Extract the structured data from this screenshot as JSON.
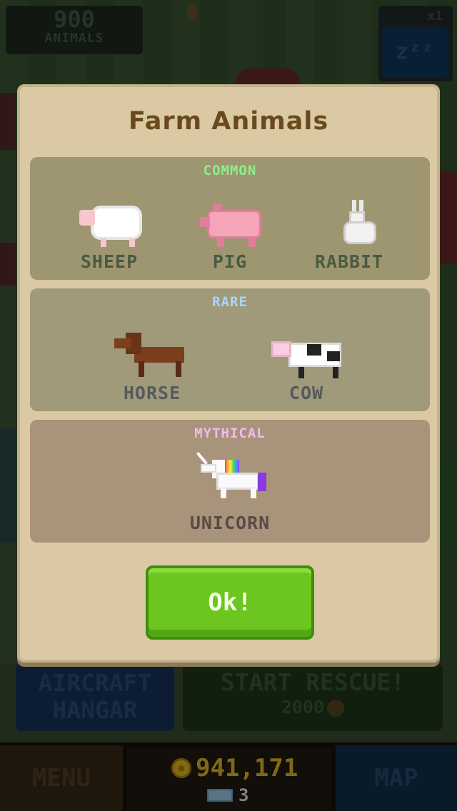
{
  "hud": {
    "animal_count": "900",
    "animal_count_label": "ANIMALS",
    "speed_multiplier": "x1",
    "sleep_label": "zᶻᶻ"
  },
  "modal": {
    "title": "Farm Animals",
    "sections": [
      {
        "label": "COMMON",
        "color": "#8af08a",
        "animals": [
          {
            "name": "SHEEP",
            "icon": "sheep-icon"
          },
          {
            "name": "PIG",
            "icon": "pig-icon"
          },
          {
            "name": "RABBIT",
            "icon": "rabbit-icon"
          }
        ]
      },
      {
        "label": "RARE",
        "color": "#a9d6ff",
        "animals": [
          {
            "name": "HORSE",
            "icon": "horse-icon"
          },
          {
            "name": "COW",
            "icon": "cow-icon"
          }
        ]
      },
      {
        "label": "MYTHICAL",
        "color": "#f3b9f0",
        "animals": [
          {
            "name": "UNICORN",
            "icon": "unicorn-icon"
          }
        ]
      }
    ],
    "ok_label": "Ok!"
  },
  "background_buttons": {
    "aircraft_line1": "AIRCRAFT",
    "aircraft_line2": "HANGAR",
    "rescue_title": "START RESCUE!",
    "rescue_cost": "2000"
  },
  "bottom_bar": {
    "menu_label": "MENU",
    "map_label": "MAP",
    "coins": "941,171",
    "gems": "3"
  }
}
